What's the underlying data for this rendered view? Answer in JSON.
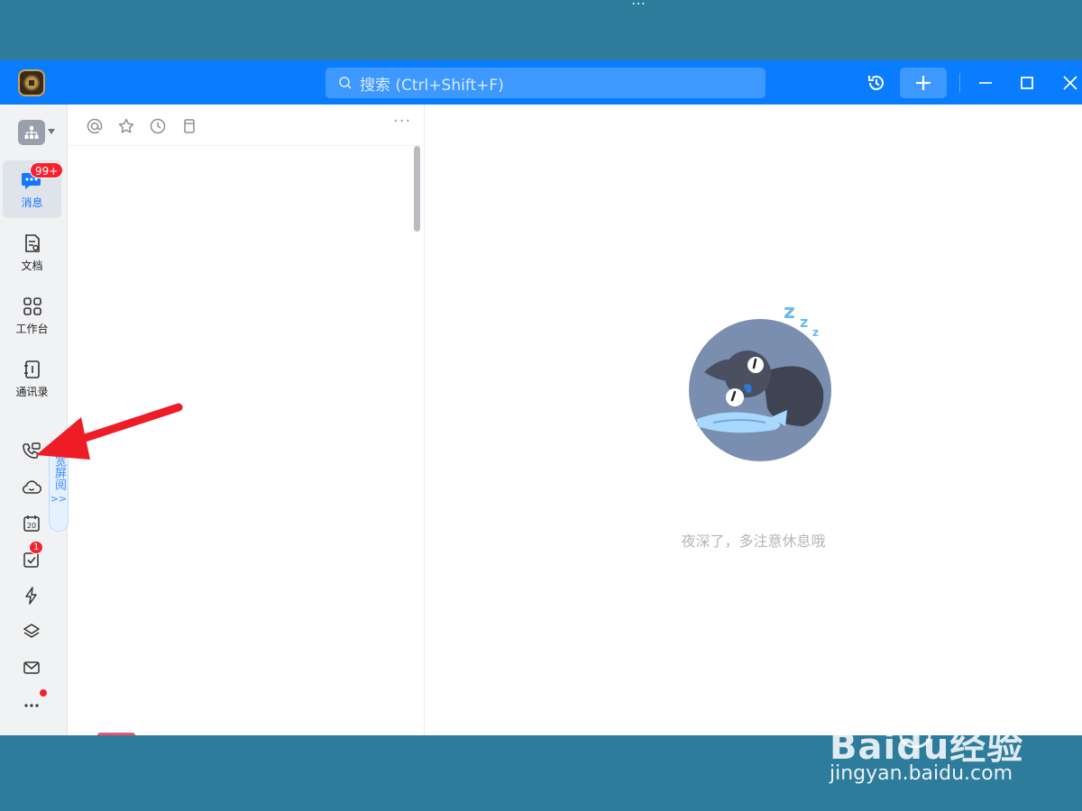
{
  "background_strip": {
    "cut_text": "…"
  },
  "titlebar": {
    "search_placeholder": "搜索 (Ctrl+Shift+F)",
    "icons": [
      "history-icon",
      "plus-icon",
      "minimize-icon",
      "maximize-icon",
      "close-icon"
    ]
  },
  "sidebar": {
    "items": [
      {
        "id": "messages",
        "label": "消息",
        "icon": "chat-bubble-icon",
        "badge": "99+",
        "active": true
      },
      {
        "id": "docs",
        "label": "文档",
        "icon": "document-icon"
      },
      {
        "id": "workbench",
        "label": "工作台",
        "icon": "grid-icon"
      },
      {
        "id": "contacts",
        "label": "通讯录",
        "icon": "address-book-icon"
      }
    ],
    "small_items": [
      {
        "id": "call",
        "icon": "phone-video-icon"
      },
      {
        "id": "cloud",
        "icon": "cloud-icon"
      },
      {
        "id": "calendar",
        "icon": "calendar-icon",
        "text": "20"
      },
      {
        "id": "todo",
        "icon": "checkbox-icon",
        "badge": "1"
      },
      {
        "id": "flash",
        "icon": "lightning-icon"
      },
      {
        "id": "layers",
        "icon": "layers-icon"
      },
      {
        "id": "mail",
        "icon": "mail-icon"
      },
      {
        "id": "more",
        "icon": "more-dots-icon"
      }
    ],
    "wide_tab": {
      "text": "宽屏阅",
      "arrow": ">>"
    }
  },
  "list_panel": {
    "toolbar_icons": [
      "at-icon",
      "star-icon",
      "clock-icon",
      "bookmark-icon"
    ],
    "more": "···"
  },
  "main": {
    "empty_text": "夜深了，多注意休息哦"
  },
  "watermark": {
    "brand": "Baidu经验",
    "url": "jingyan.baidu.com"
  },
  "colors": {
    "titlebar": "#0a7cff",
    "accent": "#1677ff",
    "badge": "#f5222d",
    "arrow": "#ee1c25"
  }
}
